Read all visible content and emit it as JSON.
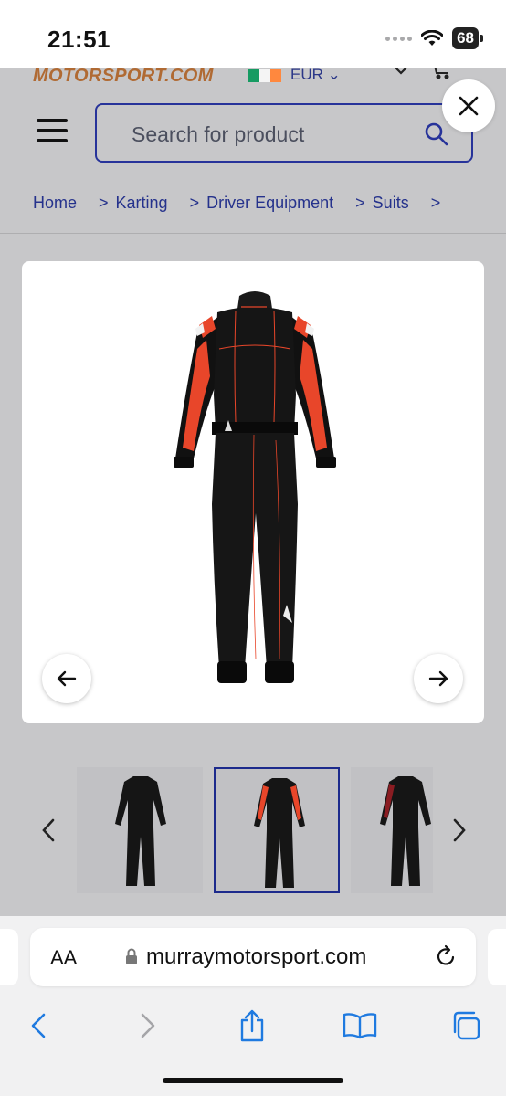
{
  "status_bar": {
    "time": "21:51",
    "battery": "68"
  },
  "header": {
    "logo_text": "MOTORSPORT.COM",
    "currency": "EUR ⌄",
    "flag_colors": [
      "#169b62",
      "#ffffff",
      "#ff883e"
    ],
    "search": {
      "placeholder": "Search for product"
    }
  },
  "breadcrumb": {
    "items": [
      "Home",
      "Karting",
      "Driver Equipment",
      "Suits"
    ],
    "separator": ">"
  },
  "product_gallery": {
    "main_image": "race-suit-black-red",
    "thumbnails": [
      "race-suit-black",
      "race-suit-black-red",
      "race-suit-black-dark-red"
    ],
    "active_thumbnail_index": 1
  },
  "browser": {
    "text_size_label": "AA",
    "url": "murraymotorsport.com"
  },
  "colors": {
    "brand_blue": "#27339a",
    "overlay_gray": "#c7c7c9",
    "suit_red": "#e8462a",
    "ios_blue": "#1f7ae0"
  }
}
